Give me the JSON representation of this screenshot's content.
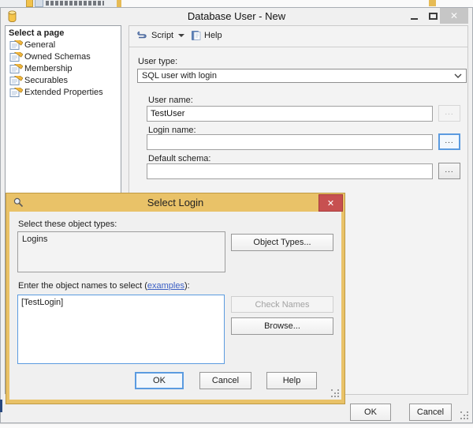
{
  "main": {
    "title": "Database User - New",
    "sidebar": {
      "header": "Select a page",
      "items": [
        {
          "label": "General"
        },
        {
          "label": "Owned Schemas"
        },
        {
          "label": "Membership"
        },
        {
          "label": "Securables"
        },
        {
          "label": "Extended Properties"
        }
      ]
    },
    "toolbar": {
      "script": "Script",
      "help": "Help"
    },
    "form": {
      "user_type_label": "User type:",
      "user_type_value": "SQL user with login",
      "user_name_label": "User name:",
      "user_name_value": "TestUser",
      "login_name_label": "Login name:",
      "login_name_value": "",
      "default_schema_label": "Default schema:",
      "default_schema_value": "",
      "ellipsis": "..."
    },
    "footer": {
      "ok": "OK",
      "cancel": "Cancel"
    }
  },
  "select_login": {
    "title": "Select Login",
    "object_types_label": "Select these object types:",
    "object_types_value": "Logins",
    "object_types_button": "Object Types...",
    "names_prefix": "Enter the object names to select (",
    "names_link": "examples",
    "names_suffix": "):",
    "names_value": "[TestLogin]",
    "check_names": "Check Names",
    "browse": "Browse...",
    "ok": "OK",
    "cancel": "Cancel",
    "help": "Help"
  },
  "icons": {
    "close_x": "✕"
  },
  "colors": {
    "dialog_gold": "#e9c268",
    "close_red": "#c75050",
    "focus_blue": "#5b9be0",
    "link_blue": "#3b5fc4"
  }
}
